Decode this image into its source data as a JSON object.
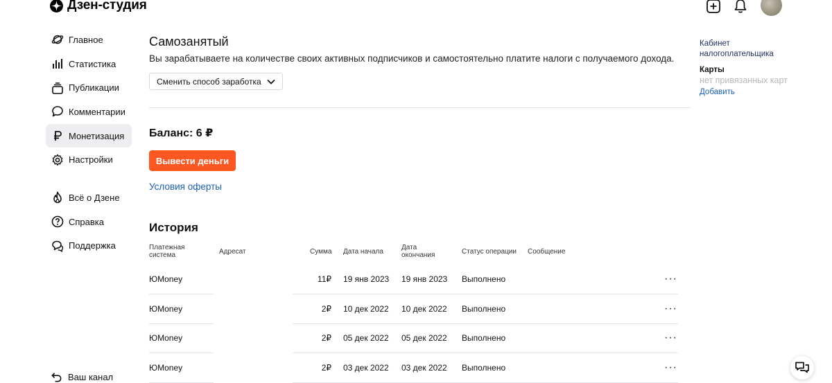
{
  "header": {
    "logo_text": "Дзен-студия"
  },
  "sidebar": {
    "items": [
      {
        "label": "Главное",
        "icon": "planet-icon"
      },
      {
        "label": "Статистика",
        "icon": "bar-chart-icon"
      },
      {
        "label": "Публикации",
        "icon": "stack-icon"
      },
      {
        "label": "Комментарии",
        "icon": "comment-icon"
      },
      {
        "label": "Монетизация",
        "icon": "ruble-icon",
        "active": true
      },
      {
        "label": "Настройки",
        "icon": "gear-icon"
      }
    ],
    "secondary": [
      {
        "label": "Всё о Дзене",
        "icon": "flame-icon"
      },
      {
        "label": "Справка",
        "icon": "help-icon"
      },
      {
        "label": "Поддержка",
        "icon": "support-icon"
      }
    ],
    "bottom_label": "Ваш канал"
  },
  "main": {
    "title": "Самозанятый",
    "description": "Вы зарабатываете на количестве своих активных подписчиков и самостоятельно платите налоги с получаемого дохода.",
    "switch_button": "Сменить способ заработка",
    "balance": "Баланс: 6 ₽",
    "withdraw_button": "Вывести деньги",
    "offer_link": "Условия оферты",
    "history_title": "История"
  },
  "table": {
    "headers": {
      "payment_system": "Платежная система",
      "recipient": "Адресат",
      "amount": "Сумма",
      "start_date": "Дата начала",
      "end_date": "Дата окончания",
      "status": "Статус операции",
      "message": "Сообщение"
    },
    "rows": [
      {
        "system": "ЮMoney",
        "amount": "11₽",
        "start": "19 янв 2023",
        "end": "19 янв 2023",
        "status": "Выполнено"
      },
      {
        "system": "ЮMoney",
        "amount": "2₽",
        "start": "10 дек 2022",
        "end": "10 дек 2022",
        "status": "Выполнено"
      },
      {
        "system": "ЮMoney",
        "amount": "2₽",
        "start": "05 дек 2022",
        "end": "05 дек 2022",
        "status": "Выполнено"
      },
      {
        "system": "ЮMoney",
        "amount": "2₽",
        "start": "03 дек 2022",
        "end": "03 дек 2022",
        "status": "Выполнено"
      }
    ],
    "more_glyph": "···"
  },
  "right_panel": {
    "cabinet_link": "Кабинет налогоплательщика",
    "cards_title": "Карты",
    "cards_empty": "нет привязанных карт",
    "add_link": "Добавить"
  },
  "colors": {
    "accent": "#ff5722",
    "link": "#1a5fb4",
    "active_bg": "#eeeef0"
  }
}
